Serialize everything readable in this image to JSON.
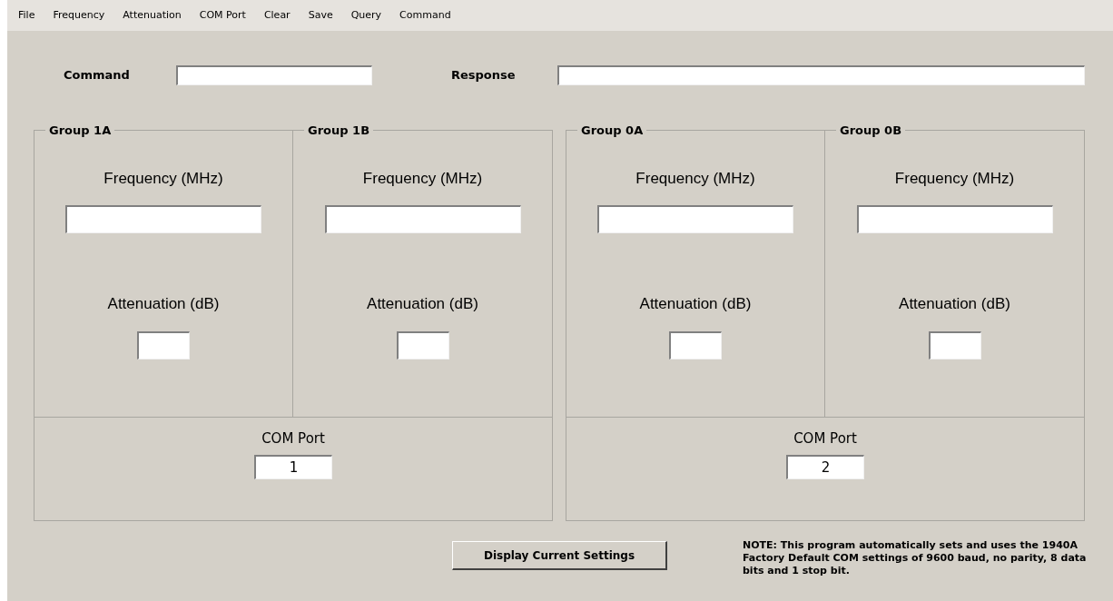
{
  "menu": [
    "File",
    "Frequency",
    "Attenuation",
    "COM Port",
    "Clear",
    "Save",
    "Query",
    "Command"
  ],
  "command": {
    "label": "Command"
  },
  "response": {
    "label": "Response"
  },
  "halves": [
    {
      "groups": [
        {
          "title": "Group 1A",
          "frequency_label": "Frequency (MHz)",
          "attenuation_label": "Attenuation (dB)"
        },
        {
          "title": "Group 1B",
          "frequency_label": "Frequency (MHz)",
          "attenuation_label": "Attenuation (dB)"
        }
      ],
      "com_port": {
        "label": "COM Port",
        "value": "1"
      }
    },
    {
      "groups": [
        {
          "title": "Group 0A",
          "frequency_label": "Frequency (MHz)",
          "attenuation_label": "Attenuation (dB)"
        },
        {
          "title": "Group 0B",
          "frequency_label": "Frequency (MHz)",
          "attenuation_label": "Attenuation (dB)"
        }
      ],
      "com_port": {
        "label": "COM Port",
        "value": "2"
      }
    }
  ],
  "button": "Display Current Settings",
  "note": "NOTE: This program automatically sets and uses the 1940A Factory Default COM settings of 9600 baud, no parity, 8 data bits and 1 stop bit."
}
